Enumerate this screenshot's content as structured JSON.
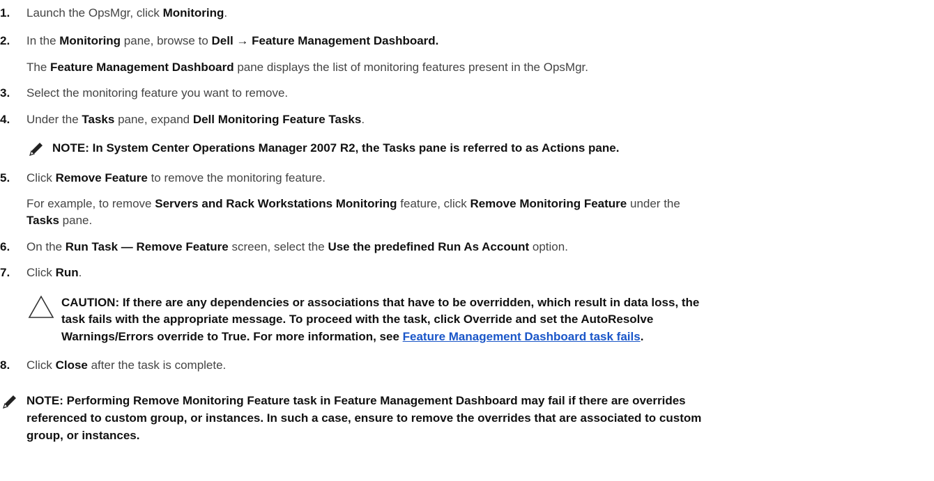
{
  "steps": [
    {
      "num": "1.",
      "pre": "Launch the OpsMgr, click ",
      "b1": "Monitoring",
      "post": "."
    },
    {
      "num": "2.",
      "pre": "In the ",
      "b1": "Monitoring",
      "mid": " pane, browse to ",
      "b2": "Dell → Feature Management Dashboard."
    },
    {
      "pre": "The ",
      "b1": "Feature Management Dashboard",
      "post": " pane displays the list of monitoring features present in the OpsMgr."
    },
    {
      "num": "3.",
      "text": "Select the monitoring feature you want to remove."
    },
    {
      "num": "4.",
      "pre": "Under the ",
      "b1": "Tasks",
      "mid": " pane, expand ",
      "b2": "Dell Monitoring Feature Tasks",
      "post": "."
    },
    {
      "num": "5.",
      "pre": "Click ",
      "b1": "Remove Feature",
      "post": " to remove the monitoring feature."
    },
    {
      "pre": "For example, to remove ",
      "b1": "Servers and Rack Workstations Monitoring",
      "mid": " feature, click ",
      "b2": "Remove Monitoring Feature",
      "post": " under the"
    },
    {
      "b1": "Tasks",
      "post": " pane."
    },
    {
      "num": "6.",
      "pre": "On the ",
      "b1": "Run Task — Remove Feature",
      "mid": " screen, select the ",
      "b2": "Use the predefined Run As Account",
      "post": " option."
    },
    {
      "num": "7.",
      "pre": "Click ",
      "b1": "Run",
      "post": "."
    },
    {
      "num": "8.",
      "pre": "Click ",
      "b1": "Close",
      "post": " after the task is complete."
    }
  ],
  "note1": "NOTE: In System Center Operations Manager 2007 R2, the Tasks pane is referred to as Actions pane.",
  "caution": {
    "line1": "CAUTION: If there are any dependencies or associations that have to be overridden, which result in data loss, the",
    "line2": "task fails with the appropriate message. To proceed with the task, click Override and set the AutoResolve",
    "line3_pre": "Warnings/Errors override to True. For more information, see ",
    "link": "Feature Management Dashboard task fails",
    "line3_post": "."
  },
  "note2": {
    "line1": "NOTE: Performing Remove Monitoring Feature task in Feature Management Dashboard may fail if there are overrides",
    "line2": "referenced to custom group, or instances. In such a case, ensure to remove the overrides that are associated to custom",
    "line3": "group, or instances."
  },
  "icons": {
    "note": "pencil-note-icon",
    "caution": "caution-triangle-icon"
  }
}
